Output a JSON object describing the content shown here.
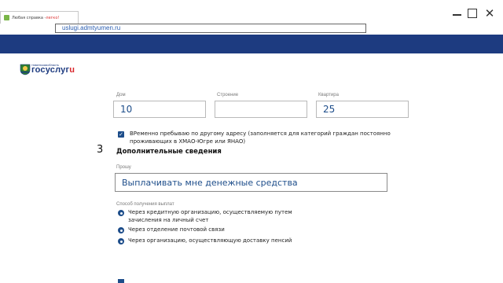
{
  "browser": {
    "tab_title": "Любая справка - ",
    "tab_title_highlight": "легко!",
    "address": "uslugi.admtyumen.ru"
  },
  "logo": {
    "small": "тюменскаяобласть",
    "main_prefix": "госуслуг",
    "main_suffix": "u"
  },
  "address_form": {
    "house_label": "Дом",
    "house_value": "10",
    "building_label": "Строение",
    "building_value": "",
    "flat_label": "Квартира",
    "flat_value": "25"
  },
  "temp_checkbox": {
    "checked": true,
    "text": "ВРеменно пребываю по другому адресу (заполняется для категорий граждан постоянно проживающих в ХМАО-Югре или ЯНАО)"
  },
  "section": {
    "number": "3",
    "title": "Дополнительные сведения",
    "request_label": "Прошу",
    "request_value": "Выплачивать мне денежные средства",
    "payment_label": "Способ получения выплат",
    "payment_options": [
      "Через кредитную организацию, осуществляемую путем зачисления на личный счет",
      "Через отделение почтовой связи",
      "Через организацию, осуществляющую доставку пенсий"
    ]
  },
  "colors": {
    "brand_blue": "#1d3b80",
    "accent_red": "#d9262c",
    "control_blue": "#1d4d8a"
  },
  "icons": {
    "favicon": "tab-favicon-icon",
    "emblem": "region-emblem-icon",
    "minimize": "minimize-icon",
    "maximize": "maximize-icon",
    "close": "close-icon"
  }
}
